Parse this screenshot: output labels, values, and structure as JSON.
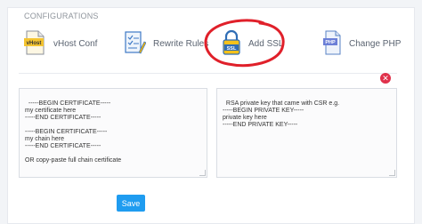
{
  "section_title": "CONFIGURATIONS",
  "tabs": [
    {
      "label": "vHost Conf",
      "icon": "vhost-file-icon"
    },
    {
      "label": "Rewrite Rules",
      "icon": "rewrite-checklist-icon"
    },
    {
      "label": "Add SSL",
      "icon": "ssl-padlock-icon"
    },
    {
      "label": "Change PHP",
      "icon": "php-file-icon"
    }
  ],
  "icon_text": {
    "vhost": "vHost",
    "ssl": "SSL",
    "php": "PHP"
  },
  "certificate_editor": {
    "value": "-----BEGIN CERTIFICATE-----\nmy certificate here\n-----END CERTIFICATE-----\n\n-----BEGIN CERTIFICATE-----\nmy chain here\n-----END CERTIFICATE-----\n\nOR copy-paste full chain certificate"
  },
  "private_key_editor": {
    "value": "RSA private key that came with CSR e.g.\n-----BEGIN PRIVATE KEY-----\nprivate key here\n-----END PRIVATE KEY-----"
  },
  "save_label": "Save",
  "colors": {
    "accent": "#1f9cf0",
    "danger": "#e0314b",
    "annotation": "#e0202a"
  }
}
